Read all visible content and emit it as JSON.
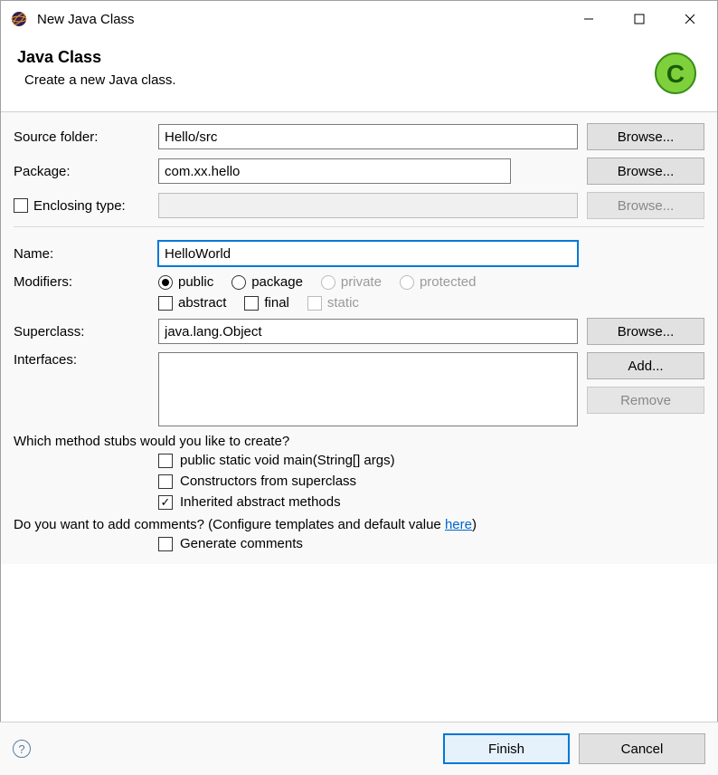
{
  "titlebar": {
    "title": "New Java Class"
  },
  "header": {
    "title": "Java Class",
    "subtitle": "Create a new Java class."
  },
  "form": {
    "source_folder_label": "Source folder:",
    "source_folder_value": "Hello/src",
    "package_label": "Package:",
    "package_value": "com.xx.hello",
    "enclosing_label": "Enclosing type:",
    "enclosing_value": "",
    "name_label": "Name:",
    "name_value": "HelloWorld",
    "modifiers_label": "Modifiers:",
    "modifiers": {
      "public": "public",
      "package": "package",
      "private": "private",
      "protected": "protected",
      "abstract": "abstract",
      "final": "final",
      "static": "static"
    },
    "superclass_label": "Superclass:",
    "superclass_value": "java.lang.Object",
    "interfaces_label": "Interfaces:",
    "stubs_question": "Which method stubs would you like to create?",
    "stub_main": "public static void main(String[] args)",
    "stub_constructors": "Constructors from superclass",
    "stub_inherited": "Inherited abstract methods",
    "comments_q1": "Do you want to add comments? (Configure templates and default value ",
    "comments_link": "here",
    "comments_q2": ")",
    "gen_comments": "Generate comments"
  },
  "buttons": {
    "browse": "Browse...",
    "add": "Add...",
    "remove": "Remove",
    "finish": "Finish",
    "cancel": "Cancel"
  }
}
